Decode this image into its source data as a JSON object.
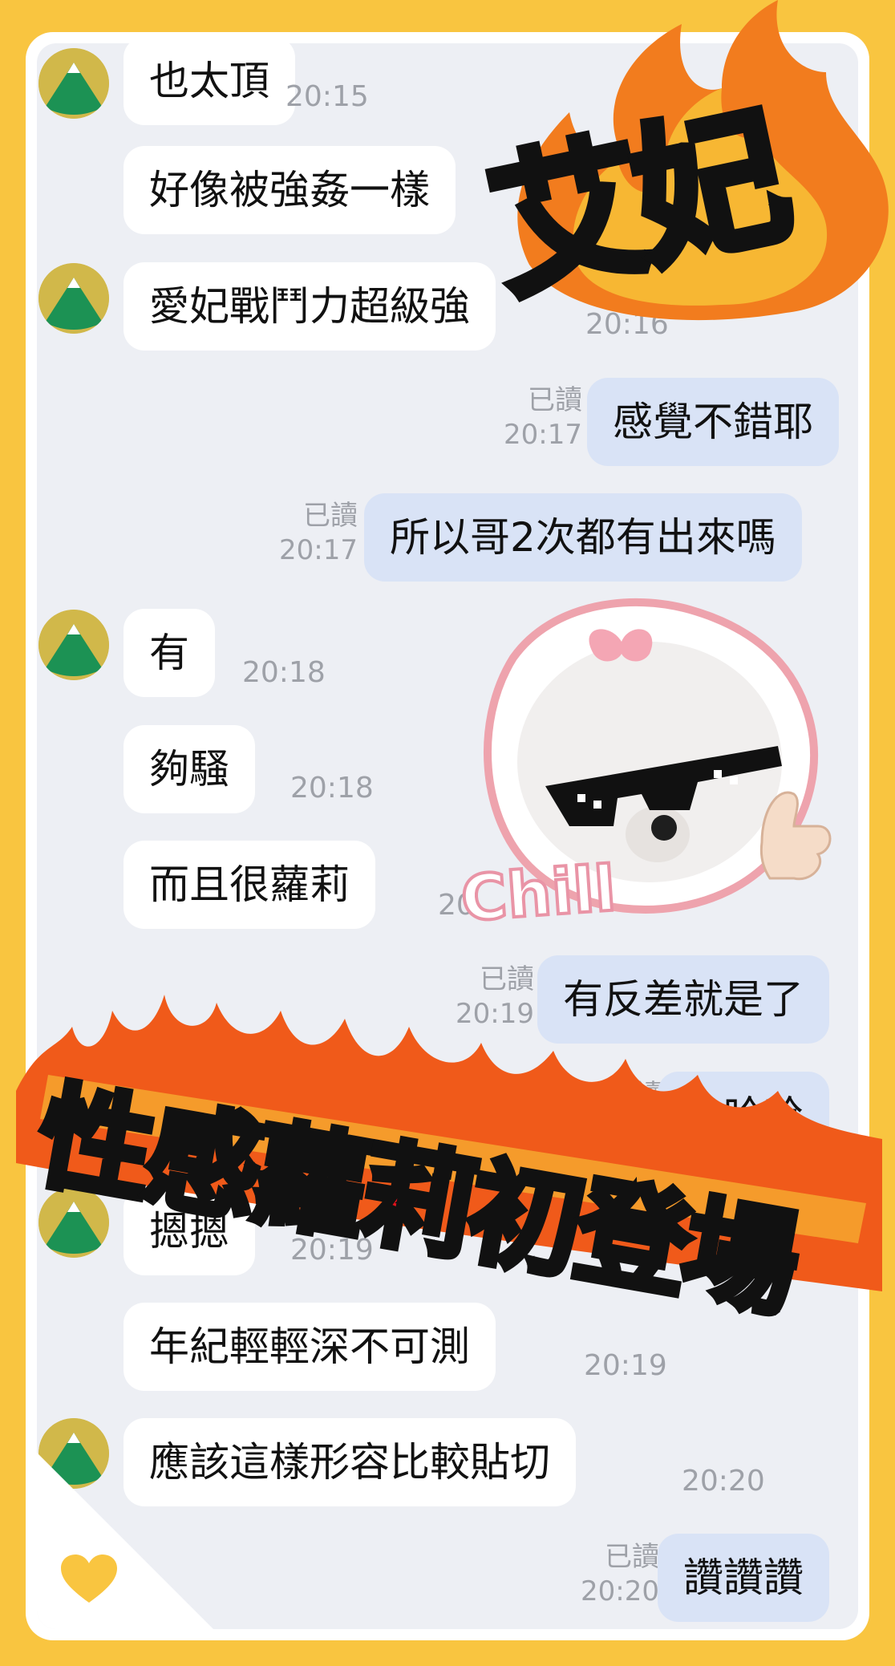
{
  "messages": [
    {
      "side": "left",
      "avatar": true,
      "text": "也太頂",
      "time": "20:15"
    },
    {
      "side": "left",
      "avatar": false,
      "text": "好像被強姦一樣",
      "time": ""
    },
    {
      "side": "left",
      "avatar": true,
      "text": "愛妃戰鬥力超級強",
      "time": "20:16"
    },
    {
      "side": "right",
      "text": "感覺不錯耶",
      "read": "已讀",
      "time": "20:17"
    },
    {
      "side": "right",
      "text": "所以哥2次都有出來嗎",
      "read": "已讀",
      "time": "20:17"
    },
    {
      "side": "left",
      "avatar": true,
      "text": "有",
      "time": "20:18"
    },
    {
      "side": "left",
      "avatar": false,
      "text": "夠騷",
      "time": "20:18"
    },
    {
      "side": "left",
      "avatar": false,
      "text": "而且很蘿莉",
      "time": "20"
    },
    {
      "side": "right",
      "text": "有反差就是了",
      "read": "已讀",
      "time": "20:19"
    },
    {
      "side": "right",
      "text": "哈哈哈",
      "read": "已讀",
      "time": "19"
    },
    {
      "side": "left",
      "avatar": true,
      "text": "摁摁",
      "time": "20:19"
    },
    {
      "side": "left",
      "avatar": false,
      "text": "年紀輕輕深不可測",
      "time": "20:19"
    },
    {
      "side": "left",
      "avatar": true,
      "text": "應該這樣形容比較貼切",
      "time": "20:20"
    },
    {
      "side": "right",
      "text": "讚讚讚",
      "read": "已讀",
      "time": "20:20"
    }
  ],
  "stickers": {
    "top_right": "艾妃",
    "dog": "Chill",
    "banner": "性感蘿莉初登場"
  },
  "icons": {
    "heart": "heart-icon",
    "avatar": "mountain-avatar-icon"
  },
  "colors": {
    "frame": "#f9c540",
    "chat_bg": "#edeff4",
    "my_bubble": "#d9e3f6",
    "banner_red": "#e1121b"
  }
}
